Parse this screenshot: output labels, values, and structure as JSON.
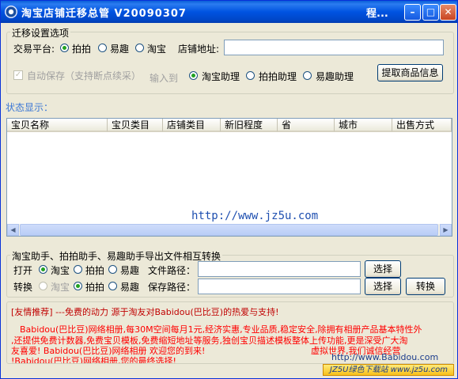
{
  "window": {
    "title": "淘宝店铺迁移总管  V20090307",
    "title_right": "程...",
    "minimize": "–",
    "maximize": "□",
    "close": "✕"
  },
  "settings": {
    "group_title": "迁移设置选项",
    "platform_label": "交易平台:",
    "platforms": [
      "拍拍",
      "易趣",
      "淘宝"
    ],
    "platform_selected": "拍拍",
    "shop_url_label": "店铺地址:",
    "shop_url_value": "",
    "autosave_label": "自动保存（支持断点续采）",
    "import_to_label": "输入到",
    "targets": [
      "淘宝助理",
      "拍拍助理",
      "易趣助理"
    ],
    "target_selected": "淘宝助理",
    "fetch_button": "提取商品信息"
  },
  "status": {
    "label": "状态显示："
  },
  "table": {
    "columns": [
      "宝贝名称",
      "宝贝类目",
      "店铺类目",
      "新旧程度",
      "省",
      "城市",
      "出售方式"
    ],
    "rows": []
  },
  "watermark": "http://www.jz5u.com",
  "convert": {
    "group_title": "淘宝助手、拍拍助手、易趣助手导出文件相互转换",
    "open_label": "打开",
    "open_options": [
      "淘宝",
      "拍拍",
      "易趣"
    ],
    "open_selected": "淘宝",
    "file_path_label": "文件路径：",
    "file_path_value": "",
    "choose_button_1": "选择",
    "convert_label": "转换",
    "convert_options": [
      "淘宝",
      "拍拍",
      "易趣"
    ],
    "convert_selected": "拍拍",
    "save_path_label": "保存路径：",
    "save_path_value": "",
    "choose_button_2": "选择",
    "convert_button": "转换"
  },
  "promo": {
    "header": "[友情推荐] ---免费的动力 源于淘友对Babidou(巴比豆)的热爱与支持!",
    "line1": "Babidou(巴比豆)网络相册,每30M空间每月1元,经济实惠,专业品质,稳定安全,除拥有相册产品基本特性外",
    "line2": ",还提供免费计数器,免费宝贝模板,免费缩短地址等服务,独创宝贝描述模板整体上传功能,更是深受广大淘",
    "line3": "友喜爱! Babidou(巴比豆)网络相册 欢迎您的到来!",
    "line3_right": "虚拟世界,我们诚信经营",
    "line4": "!Babidou(巴比豆)网络相册,您的最终选择!",
    "link": "http://www.Babidou.com",
    "badge": "JZ5U绿色下载站 www.jz5u.com"
  }
}
